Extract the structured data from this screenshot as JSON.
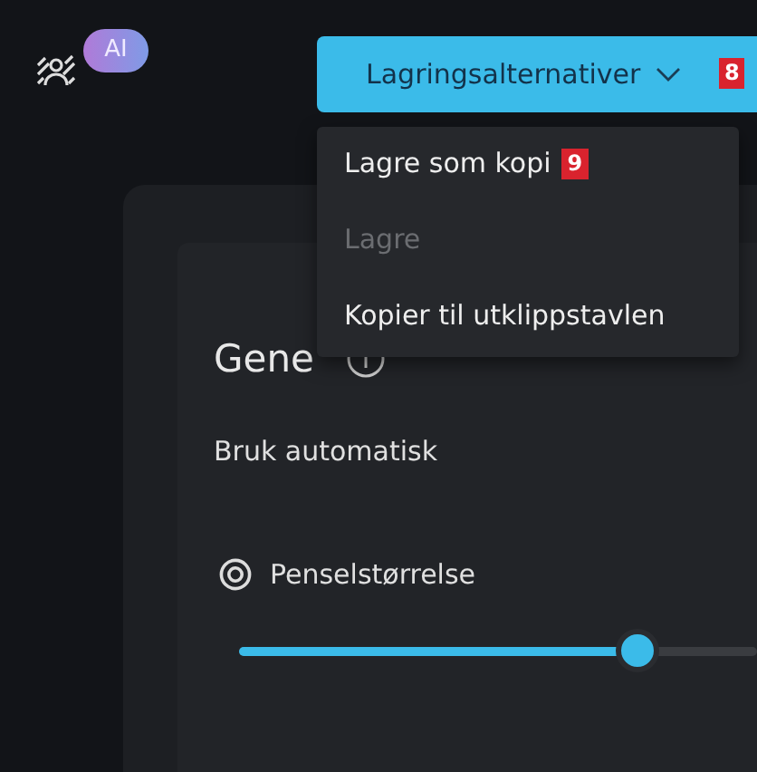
{
  "toolbar": {
    "ai_badge": "AI"
  },
  "save_button": {
    "label": "Lagringsalternativer",
    "marker": "8"
  },
  "save_menu": {
    "items": [
      {
        "label": "Lagre som kopi",
        "disabled": false,
        "marker": "9"
      },
      {
        "label": "Lagre",
        "disabled": true
      },
      {
        "label": "Kopier til utklippstavlen",
        "disabled": false
      }
    ]
  },
  "panel": {
    "title": "Gene",
    "auto_label": "Bruk automatisk",
    "brush_label": "Penselstørrelse",
    "brush_size": {
      "level": 0.76
    }
  }
}
